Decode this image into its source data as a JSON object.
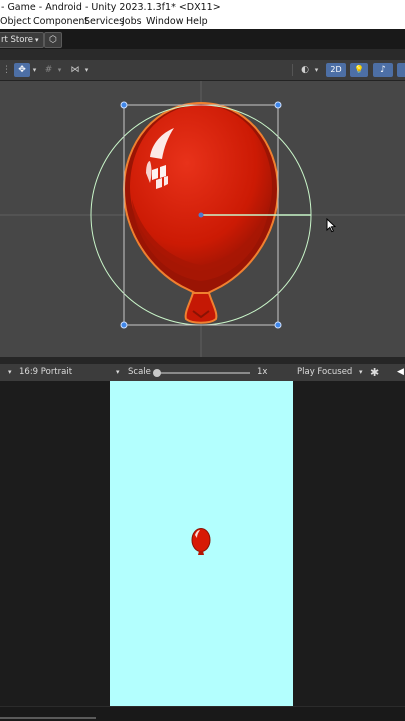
{
  "window": {
    "title": "- Game - Android - Unity 2023.1.3f1* <DX11>"
  },
  "menu": {
    "items": [
      "Object",
      "Component",
      "Services",
      "Jobs",
      "Window",
      "Help"
    ]
  },
  "toolbar": {
    "store_label": "rt Store",
    "store_caret": "▾",
    "cloud_icon": "⬡"
  },
  "scene_toolbar": {
    "mode_2d_label": "2D",
    "pivot_icon": "✥",
    "grid_icon": "#",
    "snap_icon": "⋈",
    "shading_icon": "◐",
    "light_icon": "💡",
    "audio_icon": "♪",
    "caret": "▾"
  },
  "game_toolbar": {
    "aspect_caret": "▾",
    "aspect_label": "16:9 Portrait",
    "aspect_dropdown_caret": "▾",
    "scale_label": "Scale",
    "scale_value": "1x",
    "play_mode_label": "Play Focused",
    "play_mode_caret": "▾",
    "bug_icon": "✱",
    "speaker_icon": "◀"
  },
  "colors": {
    "balloon": "#d71a05",
    "balloon_dark": "#9a1404",
    "balloon_outline": "#f08030",
    "game_background": "#b3fffe",
    "scene_background": "#474747",
    "collider_circle": "#c9f5c9",
    "rect_handle": "#3f86e8"
  }
}
